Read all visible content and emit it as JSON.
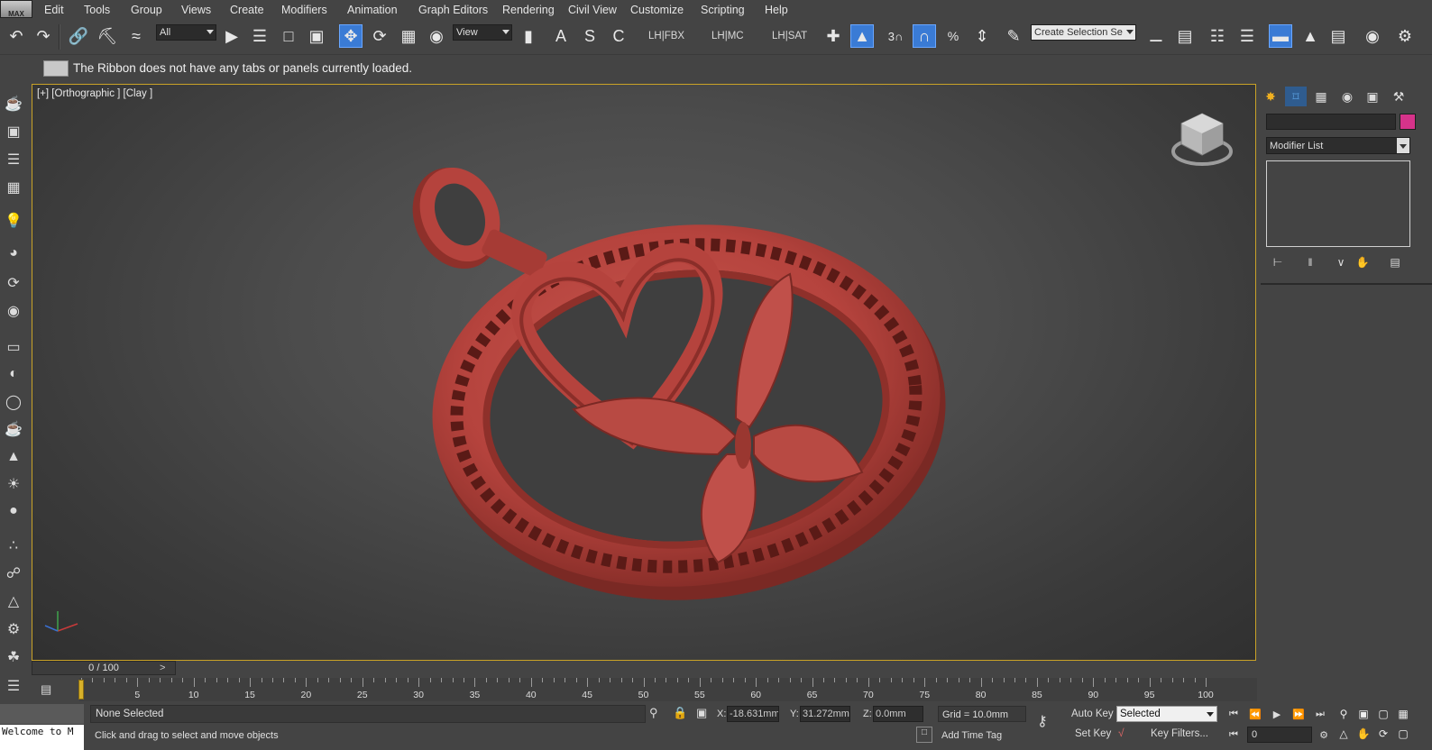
{
  "app": {
    "logo_text": "MAX"
  },
  "menu": [
    {
      "label": "Edit"
    },
    {
      "label": "Tools"
    },
    {
      "label": "Group"
    },
    {
      "label": "Views"
    },
    {
      "label": "Create"
    },
    {
      "label": "Modifiers"
    },
    {
      "label": "Animation"
    },
    {
      "label": "Graph Editors"
    },
    {
      "label": "Rendering"
    },
    {
      "label": "Civil View"
    },
    {
      "label": "Customize"
    },
    {
      "label": "Scripting"
    },
    {
      "label": "Help"
    }
  ],
  "toolbar": {
    "selection_filter": "All",
    "reference_coord": "View",
    "snap_label": "3",
    "lh_fbx": "LH|FBX",
    "lh_mc": "LH|MC",
    "lh_sat": "LH|SAT",
    "named_selection_placeholder": "Create Selection Se"
  },
  "ribbon": {
    "message": "The Ribbon does not have any tabs or panels currently loaded."
  },
  "viewport": {
    "label": "[+] [Orthographic ] [Clay ]",
    "model_color": "#b5433d",
    "border_color": "#c9a227"
  },
  "command_panel": {
    "modifier_list": "Modifier List",
    "object_color": "#d6338a"
  },
  "timeline": {
    "slider_text": "0 / 100",
    "ticks": [
      "5",
      "10",
      "15",
      "20",
      "25",
      "30",
      "35",
      "40",
      "45",
      "50",
      "55",
      "60",
      "65",
      "70",
      "75",
      "80",
      "85",
      "90",
      "95",
      "100"
    ]
  },
  "status": {
    "welcome": "Welcome to M",
    "selection": "None Selected",
    "prompt": "Click and drag to select and move objects",
    "x_label": "X:",
    "x_value": "-18.631mm",
    "y_label": "Y:",
    "y_value": "31.272mm",
    "z_label": "Z:",
    "z_value": "0.0mm",
    "grid": "Grid = 10.0mm",
    "add_time_tag": "Add Time Tag",
    "auto_key": "Auto Key",
    "set_key": "Set Key",
    "key_mode": "Selected",
    "key_filters": "Key Filters...",
    "frame": "0"
  }
}
